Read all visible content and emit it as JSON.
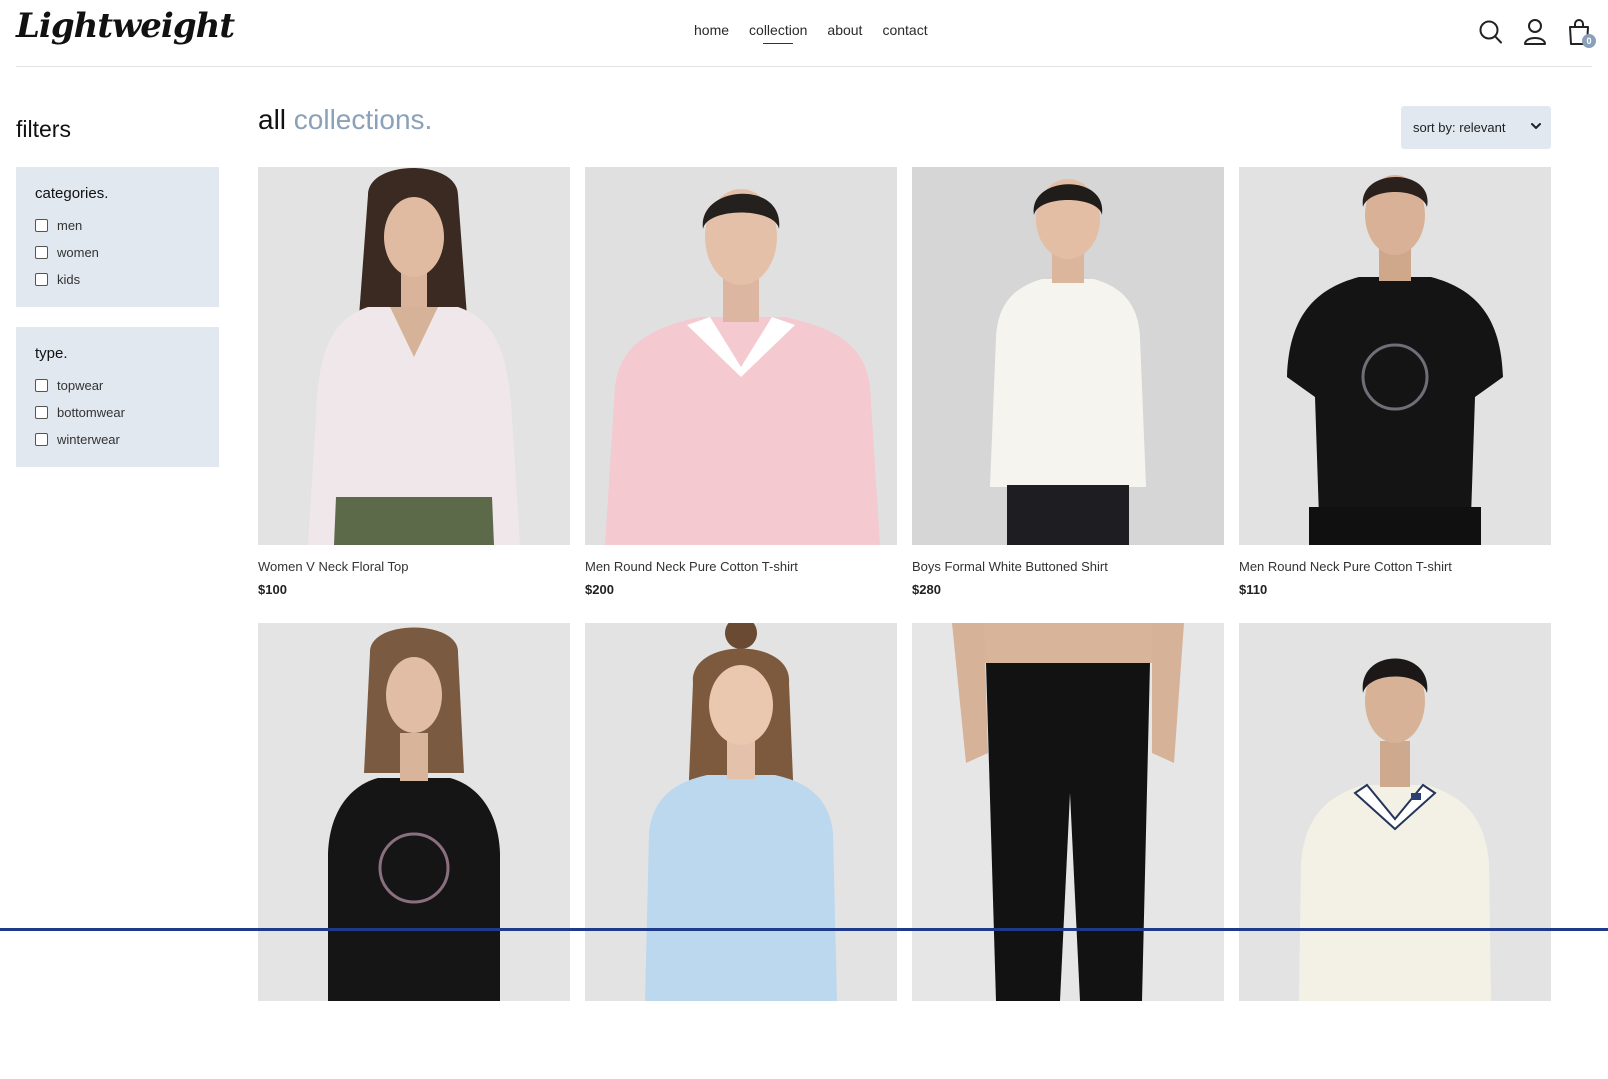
{
  "brand": {
    "logo": "Lightweight"
  },
  "nav": {
    "items": [
      "home",
      "collection",
      "about",
      "contact"
    ],
    "active": "collection"
  },
  "header_icons": {
    "search": "search-icon",
    "profile": "user-icon",
    "cart": "cart-icon",
    "cart_count": "0"
  },
  "filters": {
    "title": "filters",
    "categories": {
      "title": "categories.",
      "options": [
        "men",
        "women",
        "kids"
      ]
    },
    "type": {
      "title": "type.",
      "options": [
        "topwear",
        "bottomwear",
        "winterwear"
      ]
    }
  },
  "page": {
    "title_main": "all",
    "title_accent": "collections."
  },
  "sort": {
    "label": "sort by: relevant"
  },
  "products": [
    {
      "name": "Women V Neck Floral Top",
      "price": "$100"
    },
    {
      "name": "Men Round Neck Pure Cotton T-shirt",
      "price": "$200"
    },
    {
      "name": "Boys Formal White Buttoned Shirt",
      "price": "$280"
    },
    {
      "name": "Men Round Neck Pure Cotton T-shirt",
      "price": "$110"
    },
    {
      "name": "",
      "price": ""
    },
    {
      "name": "",
      "price": ""
    },
    {
      "name": "",
      "price": ""
    },
    {
      "name": "",
      "price": ""
    }
  ],
  "colors": {
    "accent": "#8ba0b9",
    "filter_bg": "#e2e8f0",
    "bottom_bar": "#1f3a8a"
  }
}
